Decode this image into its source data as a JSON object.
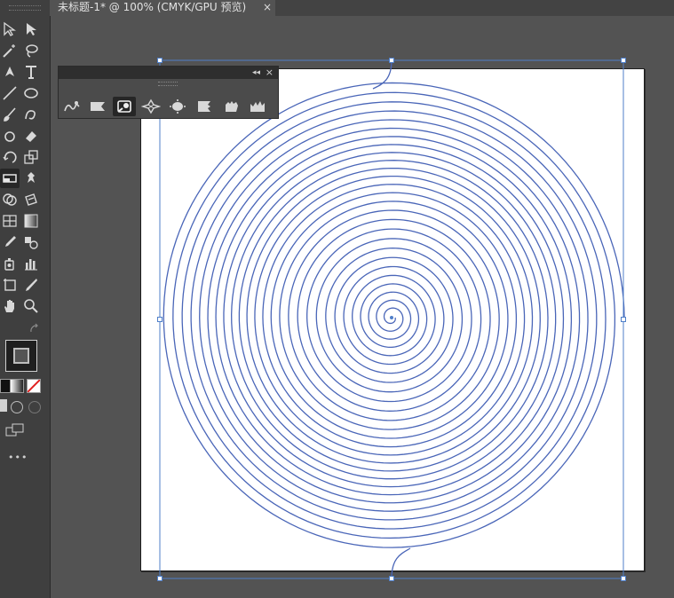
{
  "document": {
    "tab_title": "未标题-1* @ 100% (CMYK/GPU 预览)",
    "close_glyph": "×"
  },
  "toolbar": {
    "tools": [
      "selection-icon",
      "direct-selection-icon",
      "magic-wand-icon",
      "lasso-icon",
      "pen-icon",
      "type-icon",
      "line-segment-icon",
      "ellipse-icon",
      "paintbrush-icon",
      "shaper-icon",
      "blob-brush-icon",
      "eraser-icon",
      "rotate-icon",
      "scale-icon",
      "width-icon",
      "free-transform-icon",
      "shape-builder-icon",
      "live-paint-icon",
      "perspective-grid-icon",
      "gradient-icon",
      "eyedropper-icon",
      "blend-icon",
      "symbol-sprayer-icon",
      "column-graph-icon",
      "artboard-icon",
      "slice-icon",
      "hand-icon",
      "zoom-icon"
    ],
    "more_label": "•••"
  },
  "panel": {
    "collapse_glyph": "◂◂",
    "close_glyph": "×",
    "tools": [
      "pucker-icon",
      "warp-icon",
      "twirl-icon",
      "crystallize-icon",
      "bloat-icon",
      "scallop-icon",
      "wrinkle-icon",
      "crown-icon"
    ],
    "active_tool": "twirl-icon"
  },
  "colors": {
    "spiral_stroke": "#4a66b8",
    "selection": "#4f7fc9",
    "fill_swatch": "#ffffff",
    "none_swatch": "#e02020"
  }
}
